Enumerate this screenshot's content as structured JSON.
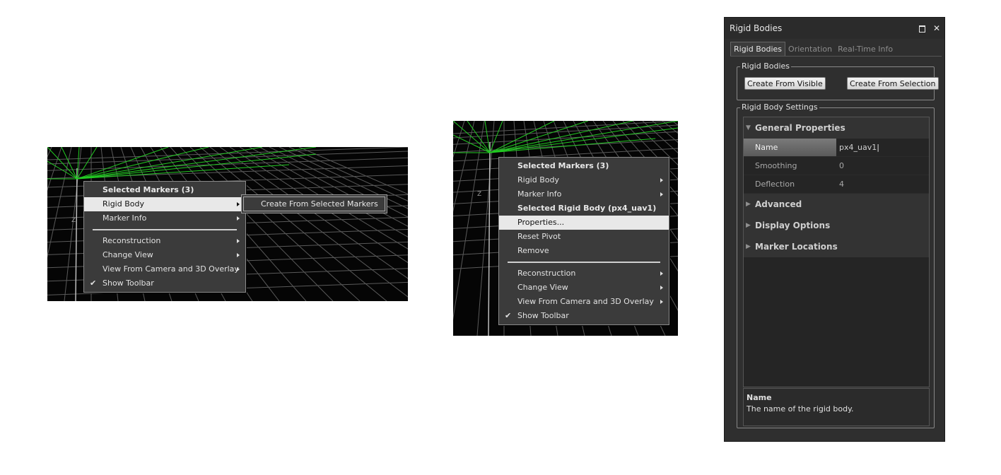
{
  "menu1": {
    "items": [
      {
        "label": "Selected Markers (3)",
        "kind": "header"
      },
      {
        "label": "Rigid Body",
        "kind": "item",
        "submenu": true,
        "highlight": true
      },
      {
        "label": "Marker Info",
        "kind": "item",
        "submenu": true
      },
      {
        "kind": "separator"
      },
      {
        "label": "Reconstruction",
        "kind": "item",
        "submenu": true
      },
      {
        "label": "Change View",
        "kind": "item",
        "submenu": true
      },
      {
        "label": "View From Camera and 3D Overlay",
        "kind": "item",
        "submenu": true
      },
      {
        "label": "Show Toolbar",
        "kind": "item",
        "checked": true
      }
    ],
    "submenu_item": "Create From Selected Markers"
  },
  "menu2": {
    "items": [
      {
        "label": "Selected Markers (3)",
        "kind": "header"
      },
      {
        "label": "Rigid Body",
        "kind": "item",
        "submenu": true
      },
      {
        "label": "Marker Info",
        "kind": "item",
        "submenu": true
      },
      {
        "label": "Selected Rigid Body (px4_uav1)",
        "kind": "header"
      },
      {
        "label": "Properties...",
        "kind": "item",
        "highlight": true
      },
      {
        "label": "Reset Pivot",
        "kind": "item"
      },
      {
        "label": "Remove",
        "kind": "item"
      },
      {
        "kind": "separator"
      },
      {
        "label": "Reconstruction",
        "kind": "item",
        "submenu": true
      },
      {
        "label": "Change View",
        "kind": "item",
        "submenu": true
      },
      {
        "label": "View From Camera and 3D Overlay",
        "kind": "item",
        "submenu": true
      },
      {
        "label": "Show Toolbar",
        "kind": "item",
        "checked": true
      }
    ]
  },
  "viewport": {
    "axis_label": "Z"
  },
  "panel": {
    "title": "Rigid Bodies",
    "tabs": [
      "Rigid Bodies",
      "Orientation",
      "Real-Time Info"
    ],
    "group1_label": "Rigid Bodies",
    "create_visible_label": "Create From Visible",
    "create_selection_label": "Create From Selection",
    "group2_label": "Rigid Body Settings",
    "general_section": "General Properties",
    "properties": [
      {
        "key": "Name",
        "value": "px4_uav1",
        "selected": true
      },
      {
        "key": "Smoothing",
        "value": "0"
      },
      {
        "key": "Deflection",
        "value": "4"
      }
    ],
    "sections": [
      "Advanced",
      "Display Options",
      "Marker Locations"
    ],
    "desc_title": "Name",
    "desc_text": "The name of the rigid body."
  },
  "colors": {
    "grid": "#5a5a5a",
    "marker_lines": "#22cc22",
    "menu_bg": "#3b3b3b",
    "highlight": "#e8e8e8"
  }
}
